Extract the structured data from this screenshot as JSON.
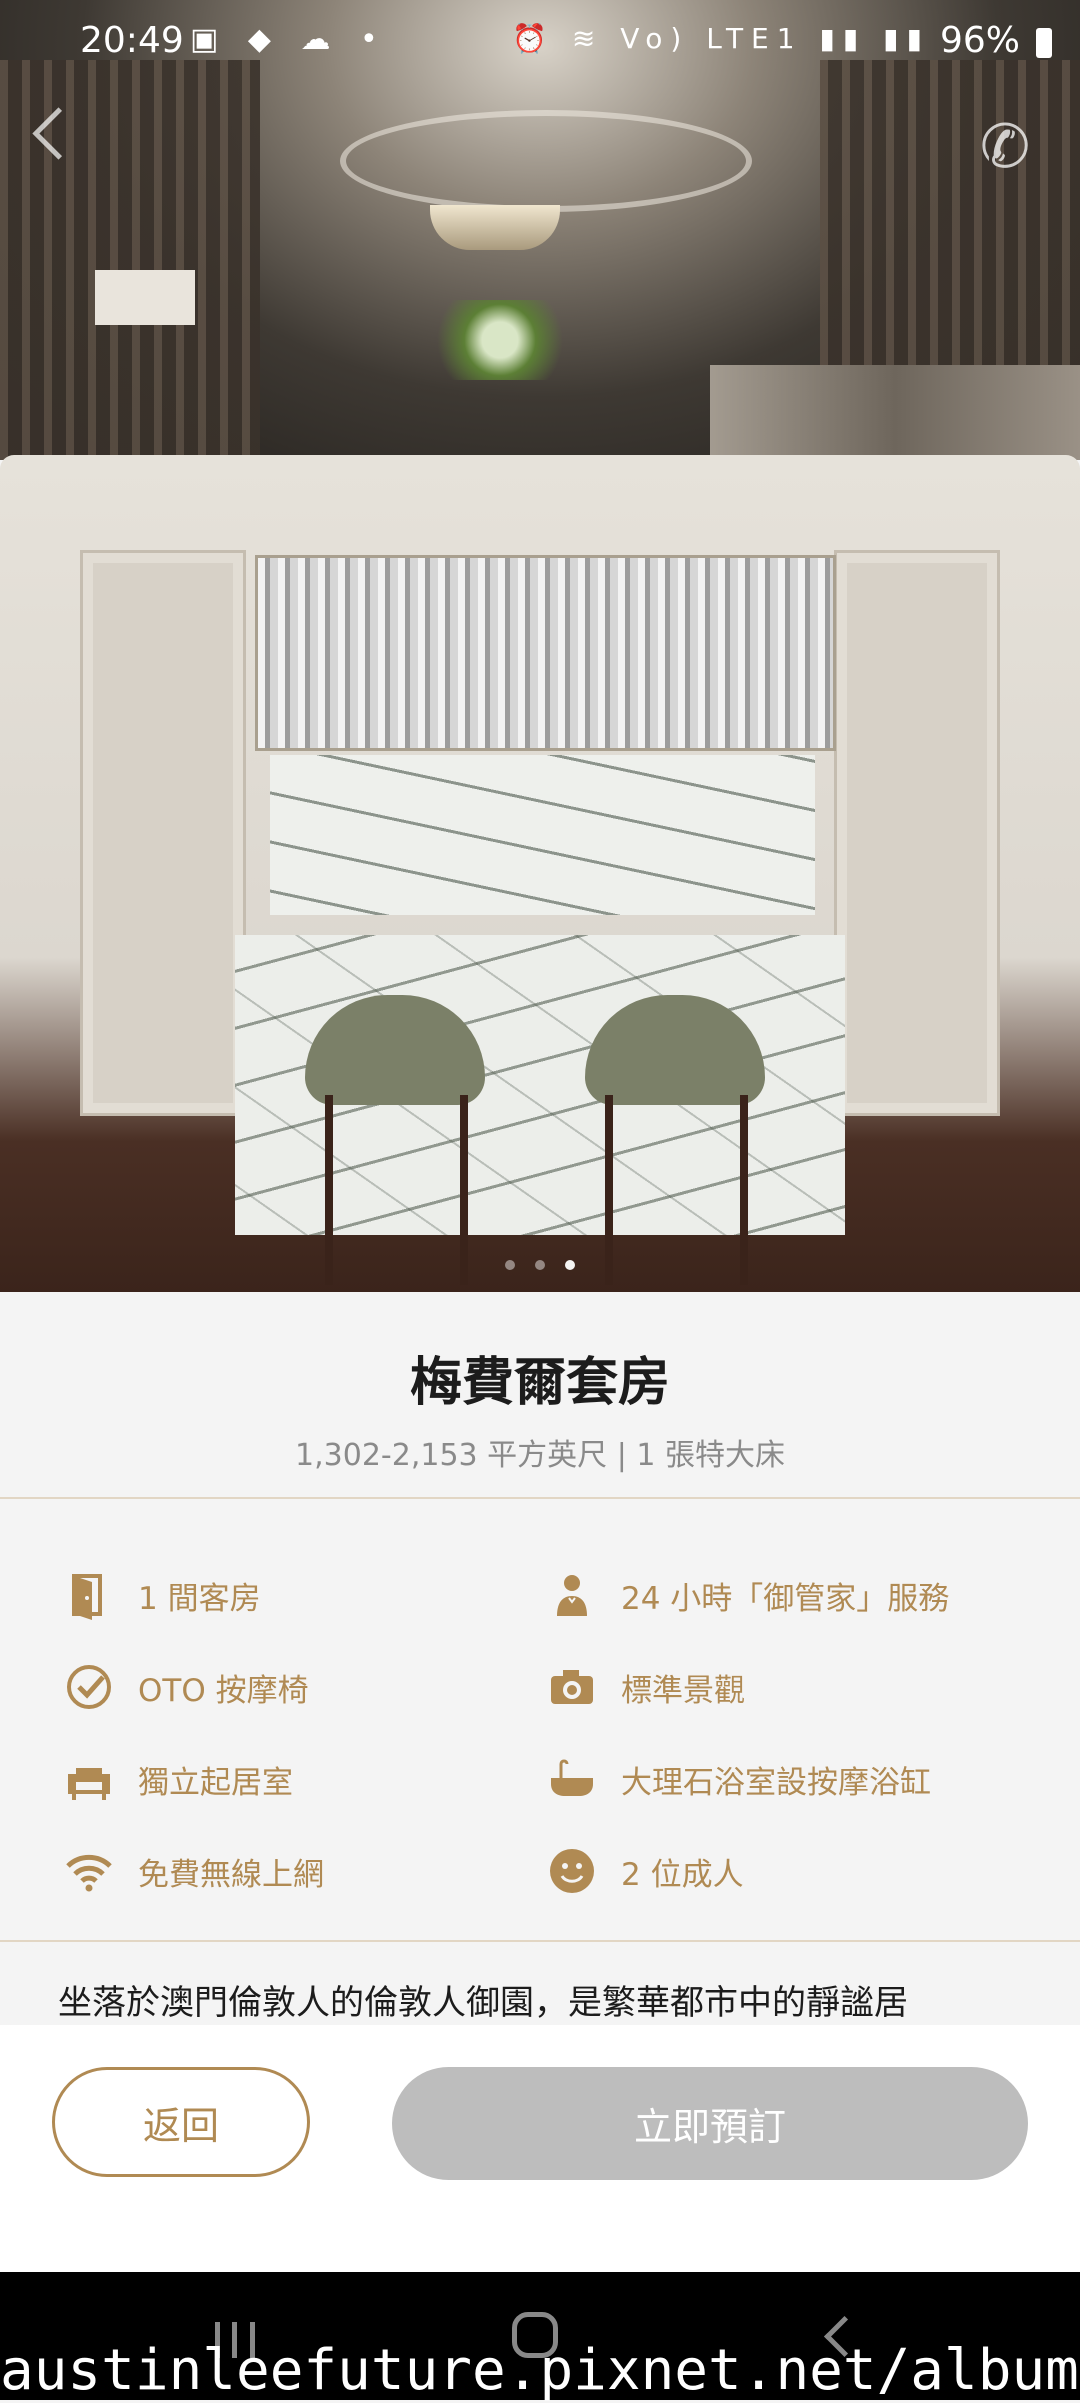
{
  "status_bar": {
    "time": "20:49",
    "left_icons": "▣ ◆ ☁ •",
    "right_icons": "⏰ ≋ Vo) LTE1 ▮▮ ▮▮",
    "battery": "96%"
  },
  "header": {
    "back_icon": "chevron-left-icon",
    "phone_icon": "phone-icon"
  },
  "gallery": {
    "pages": 3,
    "active_page": 3
  },
  "room": {
    "title": "梅費爾套房",
    "subtitle": "1,302-2,153 平方英尺 | 1 張特大床"
  },
  "features": [
    {
      "icon": "door-icon",
      "label": "1 間客房"
    },
    {
      "icon": "butler-icon",
      "label": "24 小時「御管家」服務"
    },
    {
      "icon": "check-circle-icon",
      "label": "OTO 按摩椅"
    },
    {
      "icon": "camera-icon",
      "label": "標準景觀"
    },
    {
      "icon": "armchair-icon",
      "label": "獨立起居室"
    },
    {
      "icon": "bathtub-icon",
      "label": "大理石浴室設按摩浴缸"
    },
    {
      "icon": "wifi-icon",
      "label": "免費無線上網"
    },
    {
      "icon": "smiley-icon",
      "label": "2 位成人"
    }
  ],
  "description": "坐落於澳門倫敦人的倫敦人御園，是繁華都市中的靜謐居",
  "actions": {
    "back_label": "返回",
    "book_label": "立即預訂"
  },
  "colors": {
    "accent": "#b08a53",
    "disabled_button": "#bdbdbd"
  },
  "watermark": "austinleefuture.pixnet.net/album"
}
